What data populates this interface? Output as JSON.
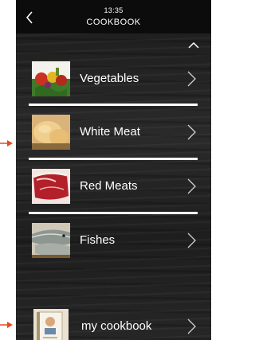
{
  "header": {
    "time": "13:35",
    "title": "COOKBOOK",
    "back_icon": "chevron-left-icon"
  },
  "scroll_up_icon": "chevron-up-icon",
  "menu": {
    "items": [
      {
        "label": "Vegetables",
        "icon": "vegetables-photo"
      },
      {
        "label": "White Meat",
        "icon": "chicken-photo"
      },
      {
        "label": "Red Meats",
        "icon": "steak-photo"
      },
      {
        "label": "Fishes",
        "icon": "fish-photo"
      }
    ]
  },
  "my_cookbook": {
    "label": "my cookbook",
    "icon": "cookbook-photo"
  },
  "colors": {
    "background": "#222222",
    "header": "#0c0c0c",
    "text": "#ffffff",
    "pointer_arrow": "#e8491d"
  }
}
